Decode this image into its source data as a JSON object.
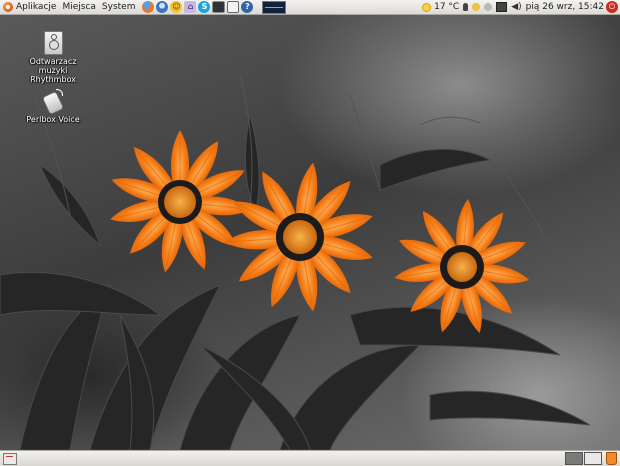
{
  "top_panel": {
    "menus": [
      "Aplikacje",
      "Miejsca",
      "System"
    ],
    "launchers": [
      {
        "icon": "firefox-icon"
      },
      {
        "icon": "thunderbird-icon"
      },
      {
        "icon": "pidgin-icon"
      },
      {
        "icon": "evolution-icon"
      },
      {
        "icon": "skype-icon"
      },
      {
        "icon": "terminal-icon"
      },
      {
        "icon": "system-monitor-icon"
      },
      {
        "icon": "help-icon",
        "glyph": "?"
      }
    ],
    "weather": {
      "icon": "sun-icon",
      "temp": "17 °C"
    },
    "clock": "pią 26 wrz, 15:42"
  },
  "desktop": {
    "icons": [
      {
        "icon": "speaker-icon",
        "label": "Odtwarzacz muzyki Rhythmbox"
      },
      {
        "icon": "phone-icon",
        "label": "Perlbox Voice"
      }
    ]
  },
  "bottom_panel": {
    "workspaces": [
      {
        "active": true
      },
      {
        "active": false
      }
    ],
    "trash_icon": "trash-icon"
  },
  "colors": {
    "flower_petal": "#f47a14",
    "flower_center": "#e08a2a",
    "panel_bg": "#e8e6e1",
    "power_button": "#cc2a1c"
  }
}
